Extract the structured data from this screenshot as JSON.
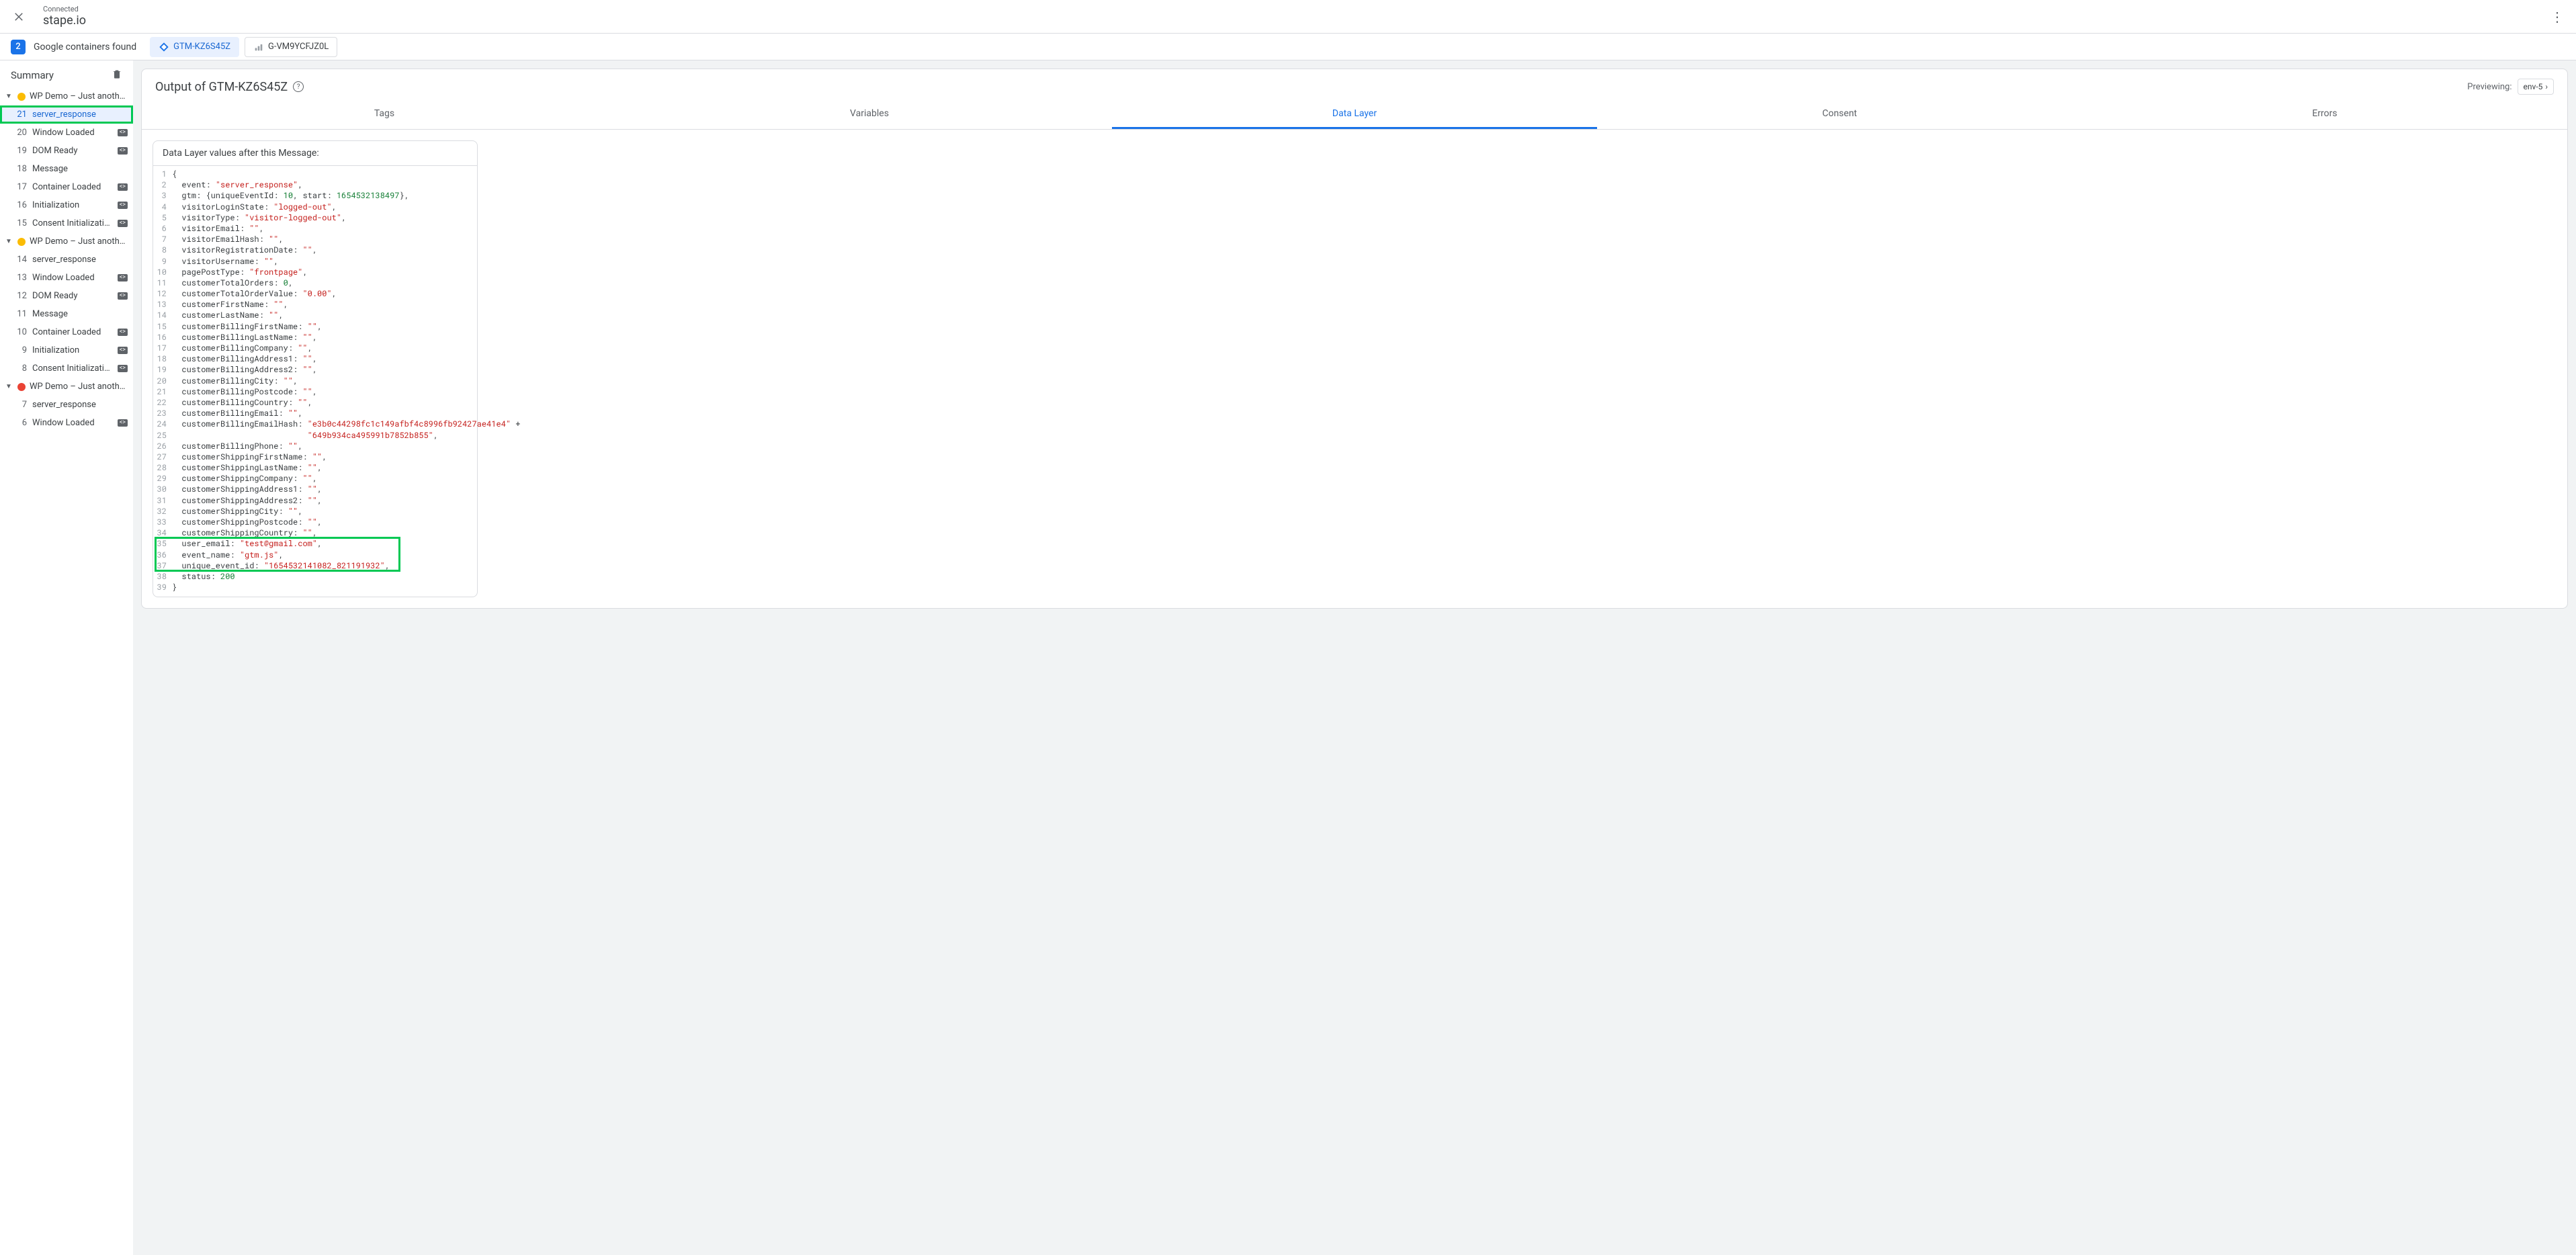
{
  "topbar": {
    "status": "Connected",
    "domain": "stape.io"
  },
  "secondbar": {
    "count": "2",
    "label": "Google containers found",
    "chips": [
      {
        "id": "GTM-KZ6S45Z",
        "active": true,
        "icon": "gtm"
      },
      {
        "id": "G-VM9YCFJZ0L",
        "active": false,
        "icon": "ga"
      }
    ]
  },
  "sidebar": {
    "title": "Summary",
    "groups": [
      {
        "status": "yellow",
        "label": "WP Demo – Just anothe...",
        "items": [
          {
            "n": "21",
            "label": "server_response",
            "badge": false,
            "selected": true,
            "highlighted": true
          },
          {
            "n": "20",
            "label": "Window Loaded",
            "badge": true
          },
          {
            "n": "19",
            "label": "DOM Ready",
            "badge": true
          },
          {
            "n": "18",
            "label": "Message",
            "badge": false
          },
          {
            "n": "17",
            "label": "Container Loaded",
            "badge": true
          },
          {
            "n": "16",
            "label": "Initialization",
            "badge": true
          },
          {
            "n": "15",
            "label": "Consent Initialization",
            "badge": true
          }
        ]
      },
      {
        "status": "yellow",
        "label": "WP Demo – Just anothe...",
        "items": [
          {
            "n": "14",
            "label": "server_response",
            "badge": false
          },
          {
            "n": "13",
            "label": "Window Loaded",
            "badge": true
          },
          {
            "n": "12",
            "label": "DOM Ready",
            "badge": true
          },
          {
            "n": "11",
            "label": "Message",
            "badge": false
          },
          {
            "n": "10",
            "label": "Container Loaded",
            "badge": true
          },
          {
            "n": "9",
            "label": "Initialization",
            "badge": true
          },
          {
            "n": "8",
            "label": "Consent Initialization",
            "badge": true
          }
        ]
      },
      {
        "status": "red",
        "label": "WP Demo – Just anothe...",
        "items": [
          {
            "n": "7",
            "label": "server_response",
            "badge": false
          },
          {
            "n": "6",
            "label": "Window Loaded",
            "badge": true
          }
        ]
      }
    ]
  },
  "content": {
    "title": "Output of GTM-KZ6S45Z",
    "previewing_label": "Previewing:",
    "env": "env-5",
    "tabs": [
      "Tags",
      "Variables",
      "Data Layer",
      "Consent",
      "Errors"
    ],
    "active_tab": 2,
    "dl_title": "Data Layer values after this Message:",
    "code": [
      [
        {
          "t": "{",
          "c": ""
        }
      ],
      [
        {
          "t": "  event: ",
          "c": ""
        },
        {
          "t": "\"server_response\"",
          "c": "str"
        },
        {
          "t": ",",
          "c": ""
        }
      ],
      [
        {
          "t": "  gtm: {uniqueEventId: ",
          "c": ""
        },
        {
          "t": "10",
          "c": "num"
        },
        {
          "t": ", start: ",
          "c": ""
        },
        {
          "t": "1654532138497",
          "c": "num"
        },
        {
          "t": "},",
          "c": ""
        }
      ],
      [
        {
          "t": "  visitorLoginState: ",
          "c": ""
        },
        {
          "t": "\"logged-out\"",
          "c": "str"
        },
        {
          "t": ",",
          "c": ""
        }
      ],
      [
        {
          "t": "  visitorType: ",
          "c": ""
        },
        {
          "t": "\"visitor-logged-out\"",
          "c": "str"
        },
        {
          "t": ",",
          "c": ""
        }
      ],
      [
        {
          "t": "  visitorEmail: ",
          "c": ""
        },
        {
          "t": "\"\"",
          "c": "str"
        },
        {
          "t": ",",
          "c": ""
        }
      ],
      [
        {
          "t": "  visitorEmailHash: ",
          "c": ""
        },
        {
          "t": "\"\"",
          "c": "str"
        },
        {
          "t": ",",
          "c": ""
        }
      ],
      [
        {
          "t": "  visitorRegistrationDate: ",
          "c": ""
        },
        {
          "t": "\"\"",
          "c": "str"
        },
        {
          "t": ",",
          "c": ""
        }
      ],
      [
        {
          "t": "  visitorUsername: ",
          "c": ""
        },
        {
          "t": "\"\"",
          "c": "str"
        },
        {
          "t": ",",
          "c": ""
        }
      ],
      [
        {
          "t": "  pagePostType: ",
          "c": ""
        },
        {
          "t": "\"frontpage\"",
          "c": "str"
        },
        {
          "t": ",",
          "c": ""
        }
      ],
      [
        {
          "t": "  customerTotalOrders: ",
          "c": ""
        },
        {
          "t": "0",
          "c": "num"
        },
        {
          "t": ",",
          "c": ""
        }
      ],
      [
        {
          "t": "  customerTotalOrderValue: ",
          "c": ""
        },
        {
          "t": "\"0.00\"",
          "c": "str"
        },
        {
          "t": ",",
          "c": ""
        }
      ],
      [
        {
          "t": "  customerFirstName: ",
          "c": ""
        },
        {
          "t": "\"\"",
          "c": "str"
        },
        {
          "t": ",",
          "c": ""
        }
      ],
      [
        {
          "t": "  customerLastName: ",
          "c": ""
        },
        {
          "t": "\"\"",
          "c": "str"
        },
        {
          "t": ",",
          "c": ""
        }
      ],
      [
        {
          "t": "  customerBillingFirstName: ",
          "c": ""
        },
        {
          "t": "\"\"",
          "c": "str"
        },
        {
          "t": ",",
          "c": ""
        }
      ],
      [
        {
          "t": "  customerBillingLastName: ",
          "c": ""
        },
        {
          "t": "\"\"",
          "c": "str"
        },
        {
          "t": ",",
          "c": ""
        }
      ],
      [
        {
          "t": "  customerBillingCompany: ",
          "c": ""
        },
        {
          "t": "\"\"",
          "c": "str"
        },
        {
          "t": ",",
          "c": ""
        }
      ],
      [
        {
          "t": "  customerBillingAddress1: ",
          "c": ""
        },
        {
          "t": "\"\"",
          "c": "str"
        },
        {
          "t": ",",
          "c": ""
        }
      ],
      [
        {
          "t": "  customerBillingAddress2: ",
          "c": ""
        },
        {
          "t": "\"\"",
          "c": "str"
        },
        {
          "t": ",",
          "c": ""
        }
      ],
      [
        {
          "t": "  customerBillingCity: ",
          "c": ""
        },
        {
          "t": "\"\"",
          "c": "str"
        },
        {
          "t": ",",
          "c": ""
        }
      ],
      [
        {
          "t": "  customerBillingPostcode: ",
          "c": ""
        },
        {
          "t": "\"\"",
          "c": "str"
        },
        {
          "t": ",",
          "c": ""
        }
      ],
      [
        {
          "t": "  customerBillingCountry: ",
          "c": ""
        },
        {
          "t": "\"\"",
          "c": "str"
        },
        {
          "t": ",",
          "c": ""
        }
      ],
      [
        {
          "t": "  customerBillingEmail: ",
          "c": ""
        },
        {
          "t": "\"\"",
          "c": "str"
        },
        {
          "t": ",",
          "c": ""
        }
      ],
      [
        {
          "t": "  customerBillingEmailHash: ",
          "c": ""
        },
        {
          "t": "\"e3b0c44298fc1c149afbf4c8996fb92427ae41e4\"",
          "c": "str"
        },
        {
          "t": " +",
          "c": ""
        }
      ],
      [
        {
          "t": "                            ",
          "c": ""
        },
        {
          "t": "\"649b934ca495991b7852b855\"",
          "c": "str"
        },
        {
          "t": ",",
          "c": ""
        }
      ],
      [
        {
          "t": "  customerBillingPhone: ",
          "c": ""
        },
        {
          "t": "\"\"",
          "c": "str"
        },
        {
          "t": ",",
          "c": ""
        }
      ],
      [
        {
          "t": "  customerShippingFirstName: ",
          "c": ""
        },
        {
          "t": "\"\"",
          "c": "str"
        },
        {
          "t": ",",
          "c": ""
        }
      ],
      [
        {
          "t": "  customerShippingLastName: ",
          "c": ""
        },
        {
          "t": "\"\"",
          "c": "str"
        },
        {
          "t": ",",
          "c": ""
        }
      ],
      [
        {
          "t": "  customerShippingCompany: ",
          "c": ""
        },
        {
          "t": "\"\"",
          "c": "str"
        },
        {
          "t": ",",
          "c": ""
        }
      ],
      [
        {
          "t": "  customerShippingAddress1: ",
          "c": ""
        },
        {
          "t": "\"\"",
          "c": "str"
        },
        {
          "t": ",",
          "c": ""
        }
      ],
      [
        {
          "t": "  customerShippingAddress2: ",
          "c": ""
        },
        {
          "t": "\"\"",
          "c": "str"
        },
        {
          "t": ",",
          "c": ""
        }
      ],
      [
        {
          "t": "  customerShippingCity: ",
          "c": ""
        },
        {
          "t": "\"\"",
          "c": "str"
        },
        {
          "t": ",",
          "c": ""
        }
      ],
      [
        {
          "t": "  customerShippingPostcode: ",
          "c": ""
        },
        {
          "t": "\"\"",
          "c": "str"
        },
        {
          "t": ",",
          "c": ""
        }
      ],
      [
        {
          "t": "  customerShippingCountry: ",
          "c": ""
        },
        {
          "t": "\"\"",
          "c": "str"
        },
        {
          "t": ",",
          "c": ""
        }
      ],
      [
        {
          "t": "  user_email: ",
          "c": ""
        },
        {
          "t": "\"test@gmail.com\"",
          "c": "str"
        },
        {
          "t": ",",
          "c": ""
        }
      ],
      [
        {
          "t": "  event_name: ",
          "c": ""
        },
        {
          "t": "\"gtm.js\"",
          "c": "str"
        },
        {
          "t": ",",
          "c": ""
        }
      ],
      [
        {
          "t": "  unique_event_id: ",
          "c": ""
        },
        {
          "t": "\"1654532141082_821191932\"",
          "c": "str"
        },
        {
          "t": ",",
          "c": ""
        }
      ],
      [
        {
          "t": "  status: ",
          "c": ""
        },
        {
          "t": "200",
          "c": "num"
        }
      ],
      [
        {
          "t": "}",
          "c": ""
        }
      ]
    ],
    "highlight_lines": [
      35,
      36,
      37
    ]
  }
}
